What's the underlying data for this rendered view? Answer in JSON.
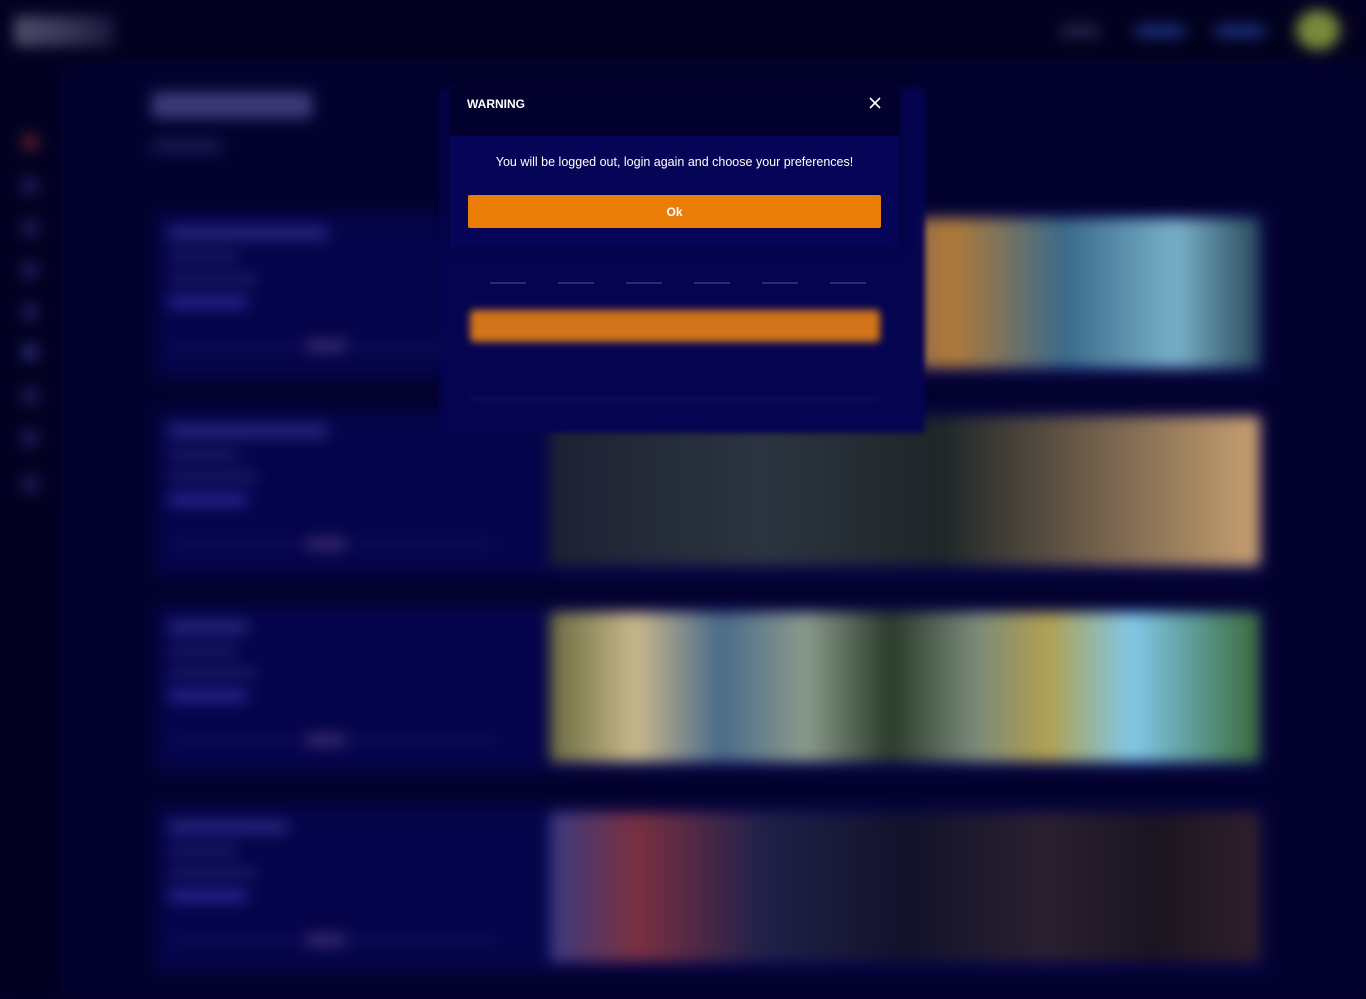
{
  "dialog": {
    "title": "WARNING",
    "message": "You will be logged out, login again and choose your preferences!",
    "ok_label": "Ok",
    "close_icon": "close-icon"
  },
  "colors": {
    "page_background": "#03022a",
    "dialog_background": "#060456",
    "dialog_header": "#02012d",
    "accent": "#ea7c08",
    "text": "#ffffff"
  }
}
